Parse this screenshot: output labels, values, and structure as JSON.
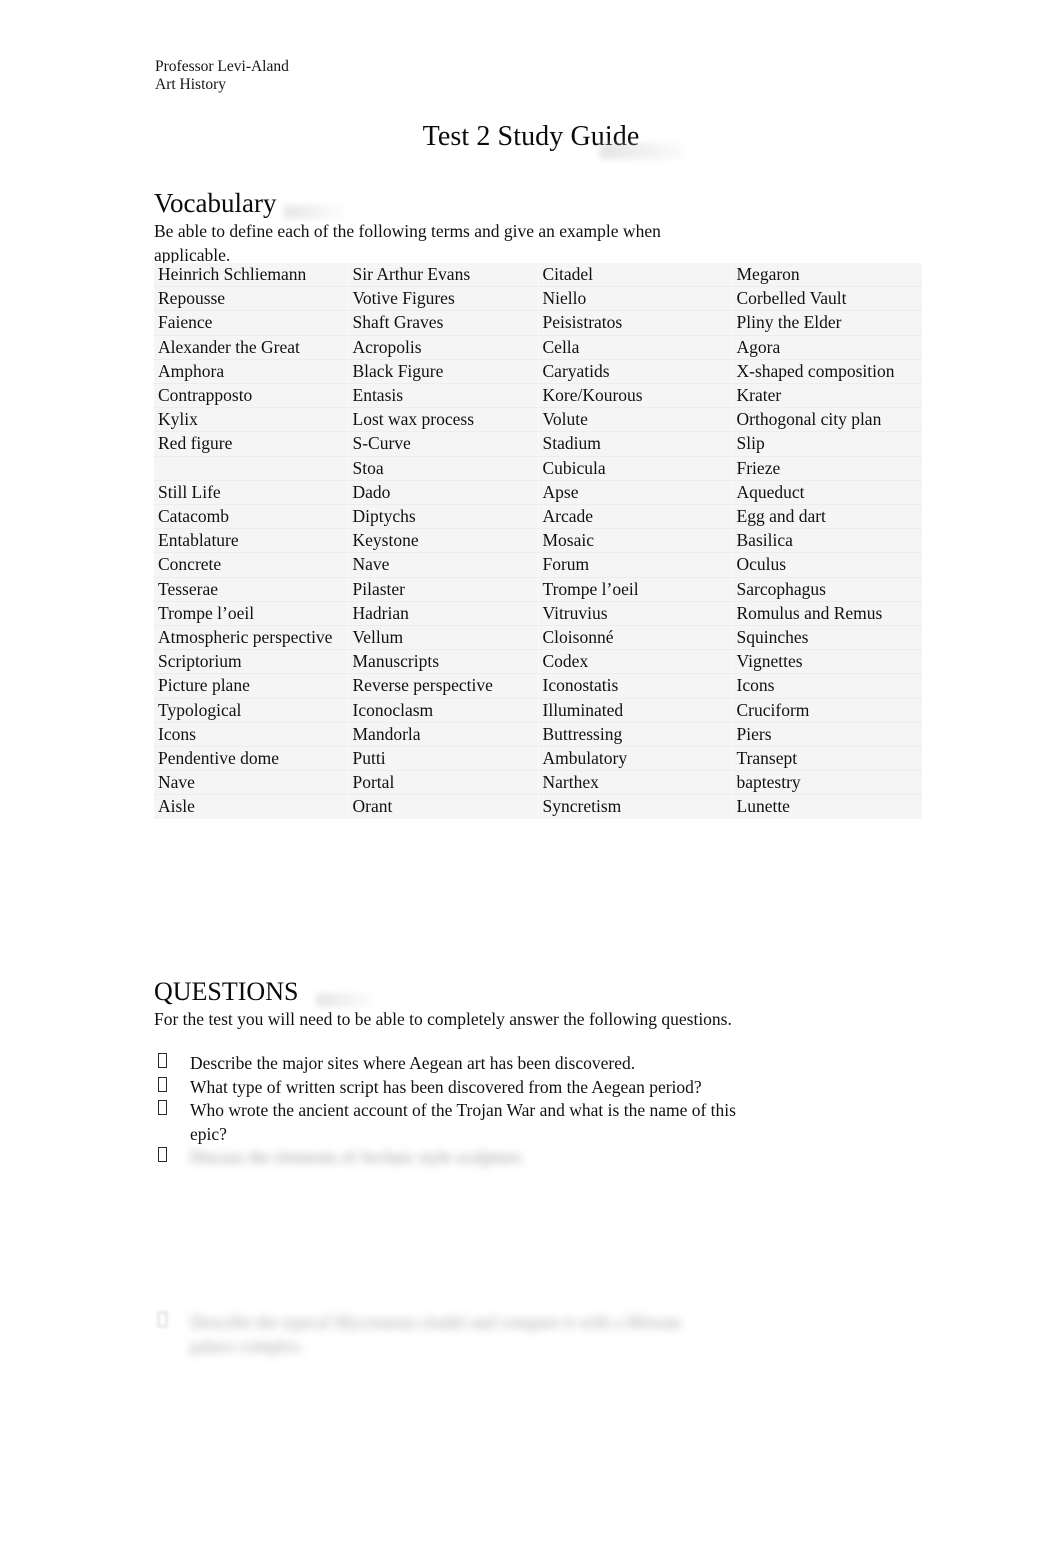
{
  "header": {
    "line1": "Professor Levi-Aland",
    "line2": "Art History"
  },
  "title": "Test 2 Study Guide",
  "vocabulary": {
    "heading": "Vocabulary",
    "intro": "Be able to define each of the following terms and give an example when applicable.",
    "rows": [
      [
        "Heinrich Schliemann",
        "Sir Arthur Evans",
        "Citadel",
        "Megaron"
      ],
      [
        "Repousse",
        "Votive Figures",
        "Niello",
        "Corbelled Vault"
      ],
      [
        "Faience",
        "Shaft Graves",
        "Peisistratos",
        "Pliny the Elder"
      ],
      [
        "Alexander the Great",
        "Acropolis",
        "Cella",
        "Agora"
      ],
      [
        "Amphora",
        "Black Figure",
        "Caryatids",
        "X-shaped composition"
      ],
      [
        "Contrapposto",
        "Entasis",
        "Kore/Kourous",
        "Krater"
      ],
      [
        "Kylix",
        "Lost wax process",
        "Volute",
        "Orthogonal city plan"
      ],
      [
        "Red figure",
        "S-Curve",
        "Stadium",
        "Slip"
      ],
      [
        "",
        "Stoa",
        "Cubicula",
        "Frieze"
      ],
      [
        "Still Life",
        "Dado",
        "Apse",
        "Aqueduct"
      ],
      [
        "Catacomb",
        "Diptychs",
        "Arcade",
        "Egg and dart"
      ],
      [
        "Entablature",
        "Keystone",
        "Mosaic",
        "Basilica"
      ],
      [
        "Concrete",
        "Nave",
        "Forum",
        "Oculus"
      ],
      [
        "Tesserae",
        "Pilaster",
        "Trompe l’oeil",
        "Sarcophagus"
      ],
      [
        "Trompe l’oeil",
        "Hadrian",
        "Vitruvius",
        "Romulus and Remus"
      ],
      [
        "Atmospheric perspective",
        "Vellum",
        "Cloisonné",
        "Squinches"
      ],
      [
        "Scriptorium",
        "Manuscripts",
        "Codex",
        "Vignettes"
      ],
      [
        "Picture plane",
        "Reverse perspective",
        "Iconostatis",
        "Icons"
      ],
      [
        "Typological",
        "Iconoclasm",
        "Illuminated",
        "Cruciform"
      ],
      [
        "Icons",
        "Mandorla",
        "Buttressing",
        "Piers"
      ],
      [
        "Pendentive dome",
        "Putti",
        "Ambulatory",
        "Transept"
      ],
      [
        "Nave",
        "Portal",
        "Narthex",
        "baptestry"
      ],
      [
        "Aisle",
        "Orant",
        "Syncretism",
        "Lunette"
      ]
    ]
  },
  "questions": {
    "heading": "QUESTIONS",
    "intro": "For the test you will need to be able to completely answer the following questions.",
    "items": [
      "Describe the major sites where Aegean art has been discovered.",
      "What type of written script has been discovered from the Aegean period?",
      "Who wrote the ancient account of the Trojan War and what is the name of this epic?",
      "Discuss the elements of Archaic style sculpture."
    ],
    "obscured_index": 3
  },
  "footnote": {
    "text": "Describe the typical Mycenaean citadel and compare it with a Minoan palace complex."
  }
}
